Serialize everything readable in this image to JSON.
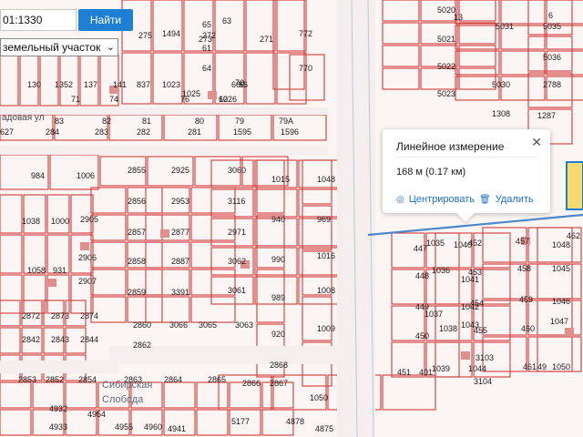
{
  "search": {
    "value": "01:1330",
    "button_label": "Найти"
  },
  "layer_select": {
    "value": "земельный участок"
  },
  "measure_popup": {
    "title": "Линейное измерение",
    "value": "168 м (0.17 км)",
    "center_label": "Центрировать",
    "delete_label": "Удалить"
  },
  "streets": {
    "sadovaya": "адовая ул",
    "sibirskaya": "Сибирская",
    "sloboda": "Слобода"
  },
  "parcel_numbers": [
    "1494",
    "1023",
    "1025",
    "837",
    "141",
    "137",
    "1352",
    "130",
    "275",
    "273",
    "272",
    "271",
    "772",
    "770",
    "65",
    "63",
    "61",
    "62",
    "64",
    "66",
    "70",
    "71",
    "74",
    "76",
    "1026",
    "660",
    "627",
    "284",
    "283",
    "282",
    "281",
    "1595",
    "1596",
    "83",
    "82",
    "81",
    "80",
    "79",
    "79А",
    "984",
    "1006",
    "2855",
    "2925",
    "3060",
    "1015",
    "1048",
    "2856",
    "2953",
    "3116",
    "940",
    "969",
    "1038",
    "1000",
    "2905",
    "1058",
    "931",
    "2906",
    "2907",
    "2857",
    "2877",
    "2971",
    "990",
    "1016",
    "2858",
    "2887",
    "3062",
    "989",
    "1008",
    "3061",
    "2859",
    "3391",
    "3066",
    "3065",
    "3063",
    "920",
    "1009",
    "2872",
    "2873",
    "2874",
    "2842",
    "2843",
    "2844",
    "2860",
    "2862",
    "2868",
    "2853",
    "2852",
    "2854",
    "2863",
    "2864",
    "2865",
    "2866",
    "2867",
    "1050",
    "4932",
    "4933",
    "4954",
    "4955",
    "4960",
    "4941",
    "5177",
    "4878",
    "4875",
    "5020",
    "5021",
    "5022",
    "5023",
    "1308",
    "5031",
    "5035",
    "5030",
    "5036",
    "2788",
    "1287",
    "13",
    "6",
    "447",
    "448",
    "449",
    "450",
    "451",
    "401",
    "452",
    "453",
    "454",
    "455",
    "3103",
    "3104",
    "457",
    "458",
    "459",
    "460",
    "461",
    "462",
    "1035",
    "1036",
    "1037",
    "1038",
    "1039",
    "1040",
    "1041",
    "1042",
    "1043",
    "1044",
    "1045",
    "1046",
    "1047",
    "1048",
    "1050",
    "49"
  ]
}
